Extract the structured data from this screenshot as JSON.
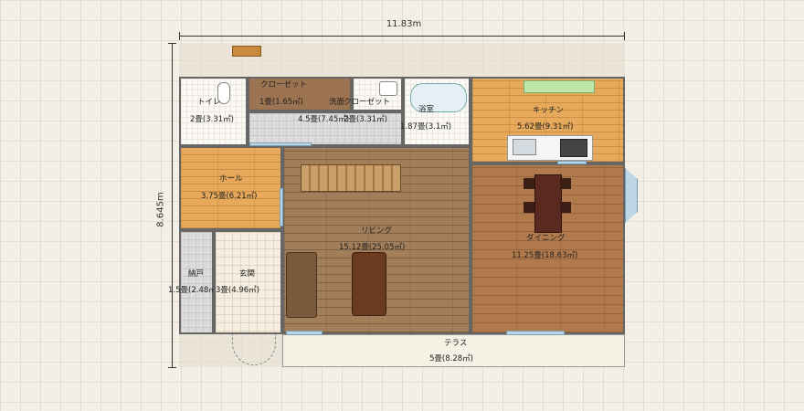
{
  "dimensions": {
    "width": "11.83m",
    "height": "8.645m"
  },
  "rooms": {
    "toilet": {
      "name": "トイレ",
      "area": "2畳(3.31㎡)"
    },
    "closet_a": {
      "name": "クローゼット",
      "area": "1畳(1.65㎡)"
    },
    "closet_b": {
      "name": "クローゼット",
      "area": "2畳(3.31㎡)"
    },
    "washroom": {
      "name": "洗面",
      "area": "4.5畳(7.45㎡)"
    },
    "bathroom": {
      "name": "浴室",
      "area": "1.87畳(3.1㎡)"
    },
    "kitchen": {
      "name": "キッチン",
      "area": "5.62畳(9.31㎡)"
    },
    "hall": {
      "name": "ホール",
      "area": "3.75畳(6.21㎡)"
    },
    "living": {
      "name": "リビング",
      "area": "15.12畳(25.05㎡)"
    },
    "dining": {
      "name": "ダイニング",
      "area": "11.25畳(18.63㎡)"
    },
    "storage": {
      "name": "納戸",
      "area": "1.5畳(2.48㎡)"
    },
    "entrance": {
      "name": "玄関",
      "area": "3畳(4.96㎡)"
    },
    "terrace": {
      "name": "テラス",
      "area": "5畳(8.28㎡)"
    }
  }
}
